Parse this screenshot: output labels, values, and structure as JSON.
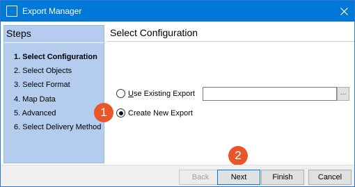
{
  "window": {
    "title": "Export Manager",
    "accent_color": "#0078d7"
  },
  "steps": {
    "header": "Steps",
    "items": [
      {
        "label": "1. Select Configuration",
        "active": true
      },
      {
        "label": "2. Select Objects",
        "active": false
      },
      {
        "label": "3. Select Format",
        "active": false
      },
      {
        "label": "4. Map Data",
        "active": false
      },
      {
        "label": "5. Advanced",
        "active": false
      },
      {
        "label": "6. Select Delivery Method",
        "active": false
      }
    ]
  },
  "main": {
    "title": "Select Configuration",
    "use_existing": {
      "underlined_char": "U",
      "rest": "se Existing Export",
      "checked": false
    },
    "create_new": {
      "label": "Create New Export",
      "checked": true
    },
    "existing_path": {
      "value": ""
    },
    "browse_label": "..."
  },
  "badges": {
    "one": "1",
    "two": "2",
    "color": "#e8562a"
  },
  "footer": {
    "back": "Back",
    "next": "Next",
    "finish": "Finish",
    "cancel": "Cancel"
  }
}
